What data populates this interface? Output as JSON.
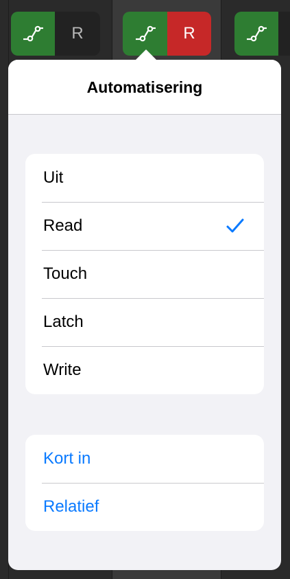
{
  "channel_strips": [
    {
      "automation_icon": "automation-curve-icon",
      "read_label": "R",
      "read_state": "off"
    },
    {
      "automation_icon": "automation-curve-icon",
      "read_label": "R",
      "read_state": "on"
    },
    {
      "automation_icon": "automation-curve-icon",
      "read_label": "",
      "read_state": "hidden"
    }
  ],
  "popover": {
    "title": "Automatisering",
    "modes": [
      {
        "label": "Uit",
        "selected": false
      },
      {
        "label": "Read",
        "selected": true
      },
      {
        "label": "Touch",
        "selected": false
      },
      {
        "label": "Latch",
        "selected": false
      },
      {
        "label": "Write",
        "selected": false
      }
    ],
    "options": [
      {
        "label": "Kort in"
      },
      {
        "label": "Relatief"
      }
    ]
  },
  "colors": {
    "automation_green": "#2e7d32",
    "read_active_red": "#c62828",
    "accent_blue": "#0a7aff"
  },
  "icons": {
    "check": "checkmark-icon"
  }
}
